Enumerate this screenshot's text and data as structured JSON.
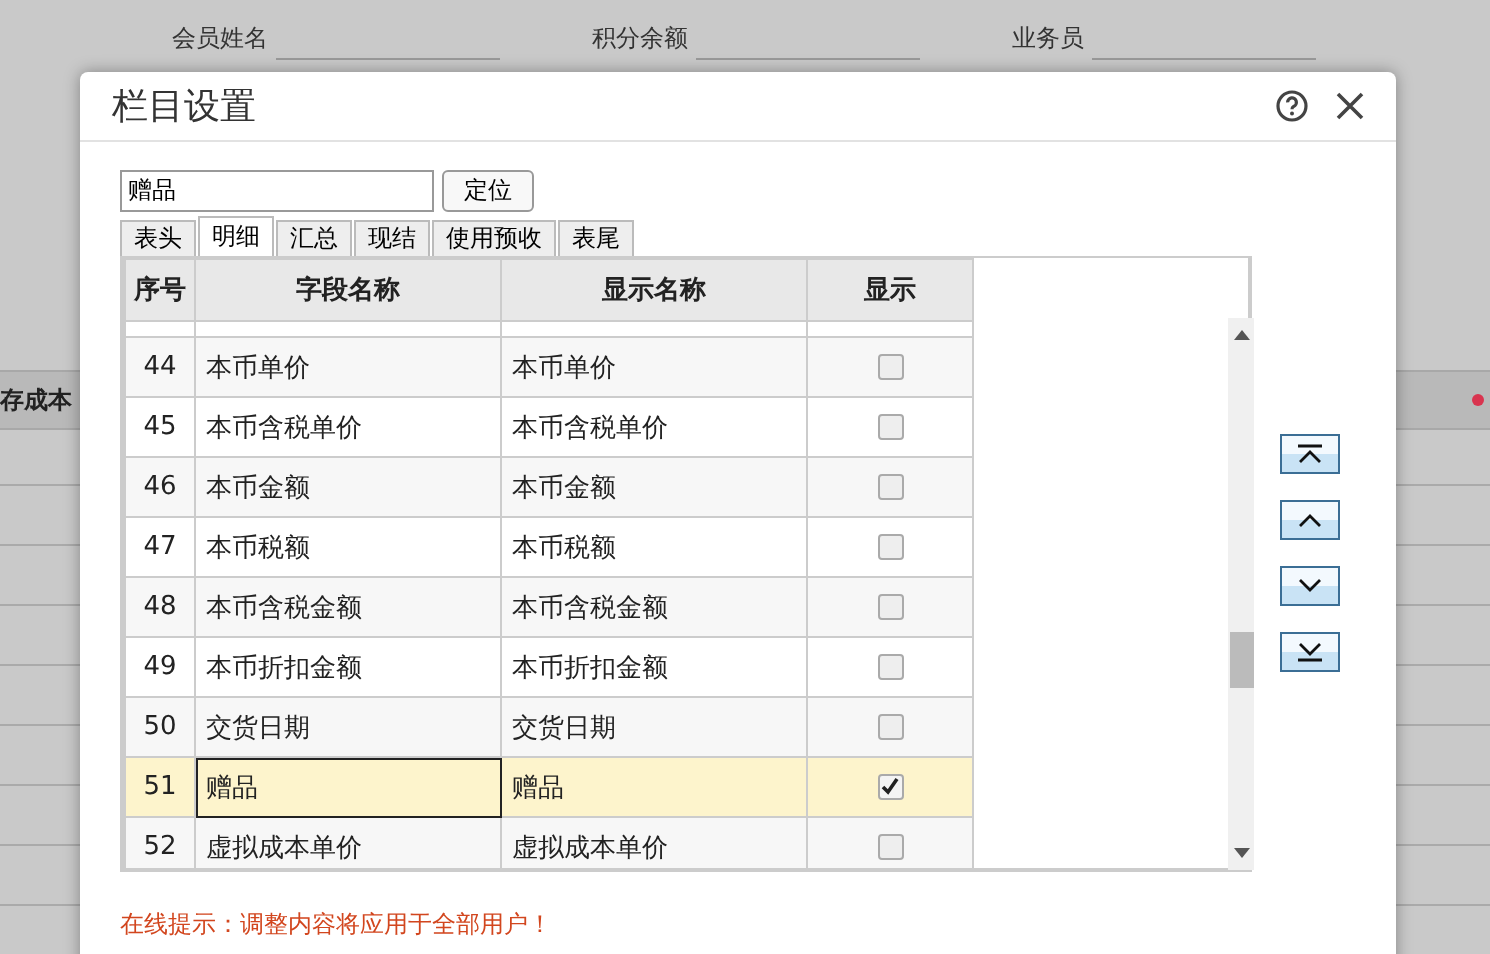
{
  "background_form": {
    "fields": [
      {
        "label": "会员姓名"
      },
      {
        "label": "积分余额"
      },
      {
        "label": "业务员"
      }
    ],
    "table_header": "存成本"
  },
  "dialog": {
    "title": "栏目设置",
    "search": {
      "value": "赠品",
      "button": "定位"
    },
    "tabs": [
      {
        "label": "表头",
        "selected": false
      },
      {
        "label": "明细",
        "selected": true
      },
      {
        "label": "汇总",
        "selected": false
      },
      {
        "label": "现结",
        "selected": false
      },
      {
        "label": "使用预收",
        "selected": false
      },
      {
        "label": "表尾",
        "selected": false
      }
    ],
    "columns": [
      "序号",
      "字段名称",
      "显示名称",
      "显示"
    ],
    "rows": [
      {
        "no": "44",
        "field": "本币单价",
        "display": "本币单价",
        "checked": false,
        "selected": false
      },
      {
        "no": "45",
        "field": "本币含税单价",
        "display": "本币含税单价",
        "checked": false,
        "selected": false
      },
      {
        "no": "46",
        "field": "本币金额",
        "display": "本币金额",
        "checked": false,
        "selected": false
      },
      {
        "no": "47",
        "field": "本币税额",
        "display": "本币税额",
        "checked": false,
        "selected": false
      },
      {
        "no": "48",
        "field": "本币含税金额",
        "display": "本币含税金额",
        "checked": false,
        "selected": false
      },
      {
        "no": "49",
        "field": "本币折扣金额",
        "display": "本币折扣金额",
        "checked": false,
        "selected": false
      },
      {
        "no": "50",
        "field": "交货日期",
        "display": "交货日期",
        "checked": false,
        "selected": false
      },
      {
        "no": "51",
        "field": "赠品",
        "display": "赠品",
        "checked": true,
        "selected": true
      },
      {
        "no": "52",
        "field": "虚拟成本单价",
        "display": "虚拟成本单价",
        "checked": false,
        "selected": false
      }
    ],
    "hint": "在线提示：调整内容将应用于全部用户！"
  }
}
